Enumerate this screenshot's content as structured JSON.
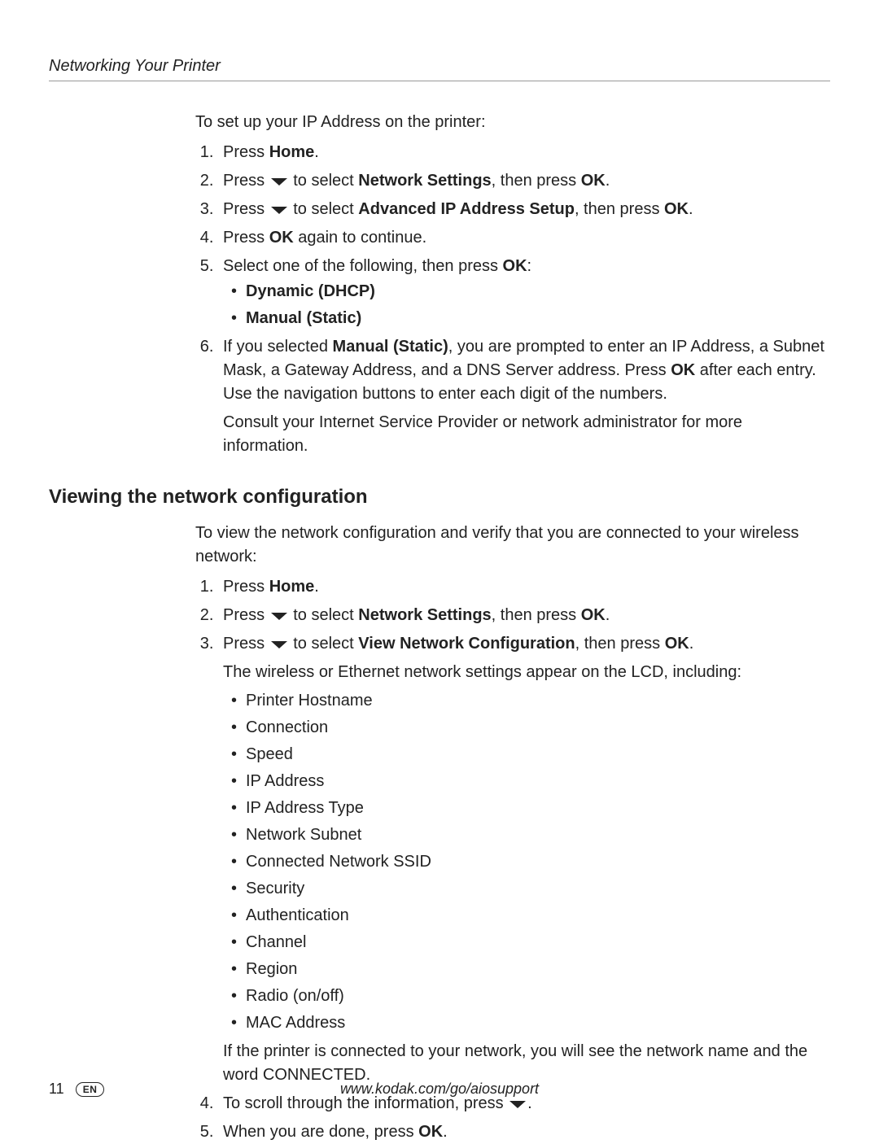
{
  "header": {
    "section_title": "Networking Your Printer"
  },
  "setup_ip": {
    "intro": "To set up your IP Address on the printer:",
    "step1_a": "Press ",
    "step1_b": "Home",
    "step1_c": ".",
    "step2_a": "Press ",
    "step2_b": " to select ",
    "step2_c": "Network Settings",
    "step2_d": ", then press ",
    "step2_e": "OK",
    "step2_f": ".",
    "step3_a": "Press ",
    "step3_b": " to select ",
    "step3_c": "Advanced IP Address Setup",
    "step3_d": ", then press ",
    "step3_e": "OK",
    "step3_f": ".",
    "step4_a": "Press ",
    "step4_b": "OK",
    "step4_c": " again to continue.",
    "step5_a": "Select one of the following, then press ",
    "step5_b": "OK",
    "step5_c": ":",
    "step5_opt1": "Dynamic (DHCP)",
    "step5_opt2": "Manual (Static)",
    "step6_a": "If you selected ",
    "step6_b": "Manual (Static)",
    "step6_c": ", you are prompted to enter an IP Address, a Subnet Mask, a Gateway Address, and a DNS Server address. Press ",
    "step6_d": "OK",
    "step6_e": " after each entry. Use the navigation buttons to enter each digit of the numbers.",
    "step6_p2": "Consult your Internet Service Provider or network administrator for more information."
  },
  "view_net": {
    "heading": "Viewing the network configuration",
    "intro": "To view the network configuration and verify that you are connected to your wireless network:",
    "step1_a": "Press ",
    "step1_b": "Home",
    "step1_c": ".",
    "step2_a": "Press ",
    "step2_b": " to select ",
    "step2_c": "Network Settings",
    "step2_d": ", then press ",
    "step2_e": "OK",
    "step2_f": ".",
    "step3_a": "Press ",
    "step3_b": " to select ",
    "step3_c": "View Network Configuration",
    "step3_d": ", then press ",
    "step3_e": "OK",
    "step3_f": ".",
    "step3_after": "The wireless or Ethernet network settings appear on the LCD, including:",
    "items": {
      "i1": "Printer Hostname",
      "i2": "Connection",
      "i3": "Speed",
      "i4": "IP Address",
      "i5": "IP Address Type",
      "i6": "Network Subnet",
      "i7": "Connected Network SSID",
      "i8": "Security",
      "i9": "Authentication",
      "i10": "Channel",
      "i11": "Region",
      "i12": "Radio (on/off)",
      "i13": "MAC Address"
    },
    "step3_after2": "If the printer is connected to your network, you will see the network name and the word CONNECTED.",
    "step4_a": "To scroll through the information, press ",
    "step4_b": ".",
    "step5_a": "When you are done, press ",
    "step5_b": "OK",
    "step5_c": "."
  },
  "footer": {
    "page_number": "11",
    "lang": "EN",
    "url": "www.kodak.com/go/aiosupport"
  }
}
